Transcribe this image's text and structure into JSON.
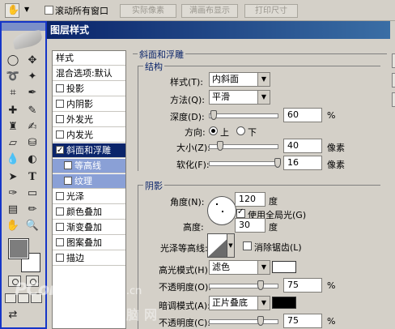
{
  "optbar": {
    "scroll_all_label": "滚动所有窗口",
    "btn_actual_pixels": "实际像素",
    "btn_fit_screen": "满画布显示",
    "btn_print_size": "打印尺寸"
  },
  "dialog": {
    "title": "图层样式",
    "style_list": {
      "header": "样式",
      "blend_options": "混合选项:默认",
      "items": [
        {
          "label": "投影",
          "checked": false
        },
        {
          "label": "内阴影",
          "checked": false
        },
        {
          "label": "外发光",
          "checked": false
        },
        {
          "label": "内发光",
          "checked": false
        },
        {
          "label": "斜面和浮雕",
          "checked": true
        },
        {
          "label": "等高线",
          "checked": false
        },
        {
          "label": "纹理",
          "checked": false
        },
        {
          "label": "光泽",
          "checked": false
        },
        {
          "label": "颜色叠加",
          "checked": false
        },
        {
          "label": "渐变叠加",
          "checked": false
        },
        {
          "label": "图案叠加",
          "checked": false
        },
        {
          "label": "描边",
          "checked": false
        }
      ]
    },
    "bevel": {
      "group_title": "斜面和浮雕",
      "structure_title": "结构",
      "style_label": "样式(T):",
      "style_value": "内斜面",
      "technique_label": "方法(Q):",
      "technique_value": "平滑",
      "depth_label": "深度(D):",
      "depth_value": "60",
      "depth_level": 0.06,
      "depth_unit": "%",
      "direction_label": "方向:",
      "direction_up": "上",
      "direction_down": "下",
      "size_label": "大小(Z):",
      "size_value": "40",
      "size_level": 0.16,
      "size_unit": "像素",
      "soften_label": "软化(F):",
      "soften_value": "16",
      "soften_level": 1.0,
      "soften_unit": "像素"
    },
    "shading": {
      "title": "阴影",
      "angle_label": "角度(N):",
      "angle_value": "120",
      "angle_unit": "度",
      "global_light_label": "使用全局光(G)",
      "altitude_label": "高度:",
      "altitude_value": "30",
      "altitude_unit": "度",
      "gloss_contour_label": "光泽等高线:",
      "anti_aliased_label": "消除锯齿(L)",
      "highlight_mode_label": "高光模式(H):",
      "highlight_mode_value": "滤色",
      "highlight_color": "#ffffff",
      "highlight_opacity_label": "不透明度(O):",
      "highlight_opacity_value": "75",
      "highlight_opacity_level": 0.75,
      "shadow_mode_label": "暗调模式(A):",
      "shadow_mode_value": "正片叠底",
      "shadow_color": "#000000",
      "shadow_opacity_label": "不透明度(C):",
      "shadow_opacity_value": "75",
      "shadow_opacity_level": 0.75,
      "percent": "%"
    }
  },
  "toolbox": {
    "foreground_color": "#7d7d7d",
    "background_color": "#ffffff"
  },
  "watermark": {
    "brand": "PConline",
    "domain": ".com.cn",
    "cn": "太平洋电脑网"
  },
  "colors": {
    "title_bar": "#0a246a",
    "selection": "#0a246a",
    "toolbox_border": "#1535c8"
  }
}
